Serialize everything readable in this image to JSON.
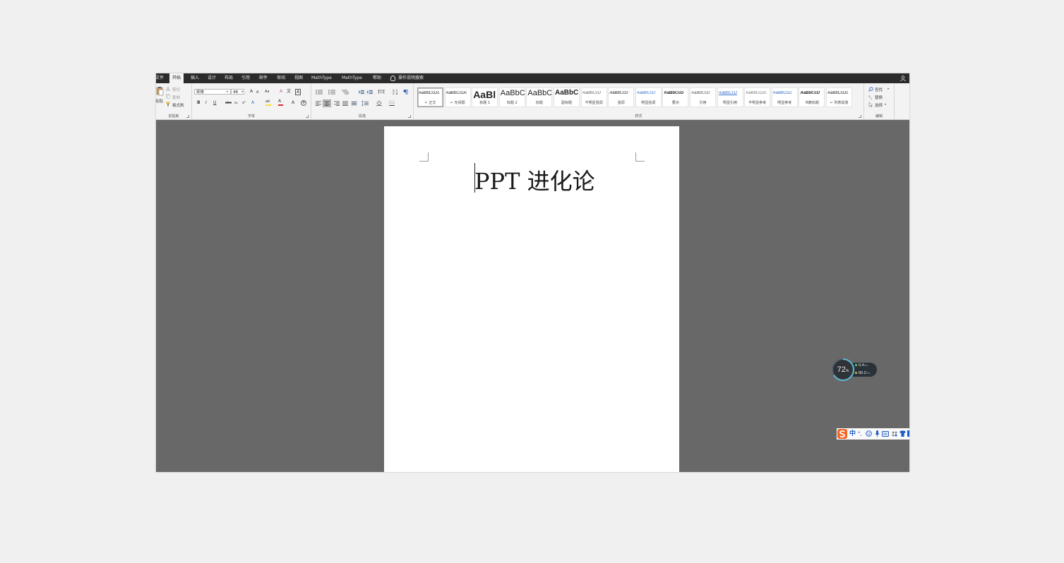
{
  "tabs": [
    "文件",
    "开始",
    "插入",
    "设计",
    "布局",
    "引用",
    "邮件",
    "审阅",
    "视图",
    "MathType",
    "MathType",
    "帮助"
  ],
  "active_tab": "开始",
  "tell_me": "操作说明搜索",
  "clipboard": {
    "paste": "粘贴",
    "cut": "剪切",
    "copy": "复制",
    "format_painter": "格式刷",
    "label": "剪贴板"
  },
  "font": {
    "font_name": "宋体",
    "font_size": "48",
    "bold": "B",
    "italic": "I",
    "underline": "U",
    "strike": "abc",
    "subscript": "x₂",
    "superscript": "x²",
    "grow": "A",
    "shrink": "A",
    "change_case": "Aa",
    "clear_format": "A",
    "phonetic": "文",
    "char_border": "A",
    "font_color": "A",
    "highlight": "ab",
    "char_shading": "A",
    "enclose": "字",
    "label": "字体"
  },
  "paragraph": {
    "label": "段落"
  },
  "styles": {
    "label": "样式",
    "items": [
      {
        "preview": "AaBbCcDc",
        "name": "↵ 正文",
        "selected": true
      },
      {
        "preview": "AaBbCcDc",
        "name": "↵ 无间隔"
      },
      {
        "preview": "AaBl",
        "name": "标题 1"
      },
      {
        "preview": "AaBbC",
        "name": "标题 2"
      },
      {
        "preview": "AaBbC",
        "name": "标题"
      },
      {
        "preview": "AaBbC",
        "name": "副标题"
      },
      {
        "preview": "AaBbCcD",
        "name": "不明显强调"
      },
      {
        "preview": "AaBbCcD",
        "name": "强调"
      },
      {
        "preview": "AaBbCcD",
        "name": "明显强调"
      },
      {
        "preview": "AaBbCcD",
        "name": "要点"
      },
      {
        "preview": "AaBbCcD",
        "name": "引用"
      },
      {
        "preview": "AaBbCcD",
        "name": "明显引用"
      },
      {
        "preview": "AaBbCcDc",
        "name": "不明显参考"
      },
      {
        "preview": "AaBbCcD",
        "name": "明显参考"
      },
      {
        "preview": "AaBbCcD",
        "name": "书籍标题"
      },
      {
        "preview": "AaBbCcDc",
        "name": "↵ 列表段落"
      }
    ]
  },
  "editing": {
    "find": "查找",
    "replace": "替换",
    "select": "选择",
    "label": "编辑"
  },
  "document": {
    "title": "PPT 进化论",
    "para_mark": "↵"
  },
  "net_monitor": {
    "cpu_percent": "72",
    "cpu_unit": "%",
    "upload": "0.4",
    "upload_unit": "K/s",
    "download": "80.2",
    "download_unit": "K/s"
  },
  "ime": {
    "mode": "中",
    "punct": "°,"
  },
  "colors": {
    "tabbar": "#2b2b2b",
    "ribbon": "#f3f3f3",
    "canvas": "#686868",
    "highlight_yellow": "#f7e13a",
    "font_red": "#d92b2b",
    "sogou_orange": "#f26522"
  }
}
